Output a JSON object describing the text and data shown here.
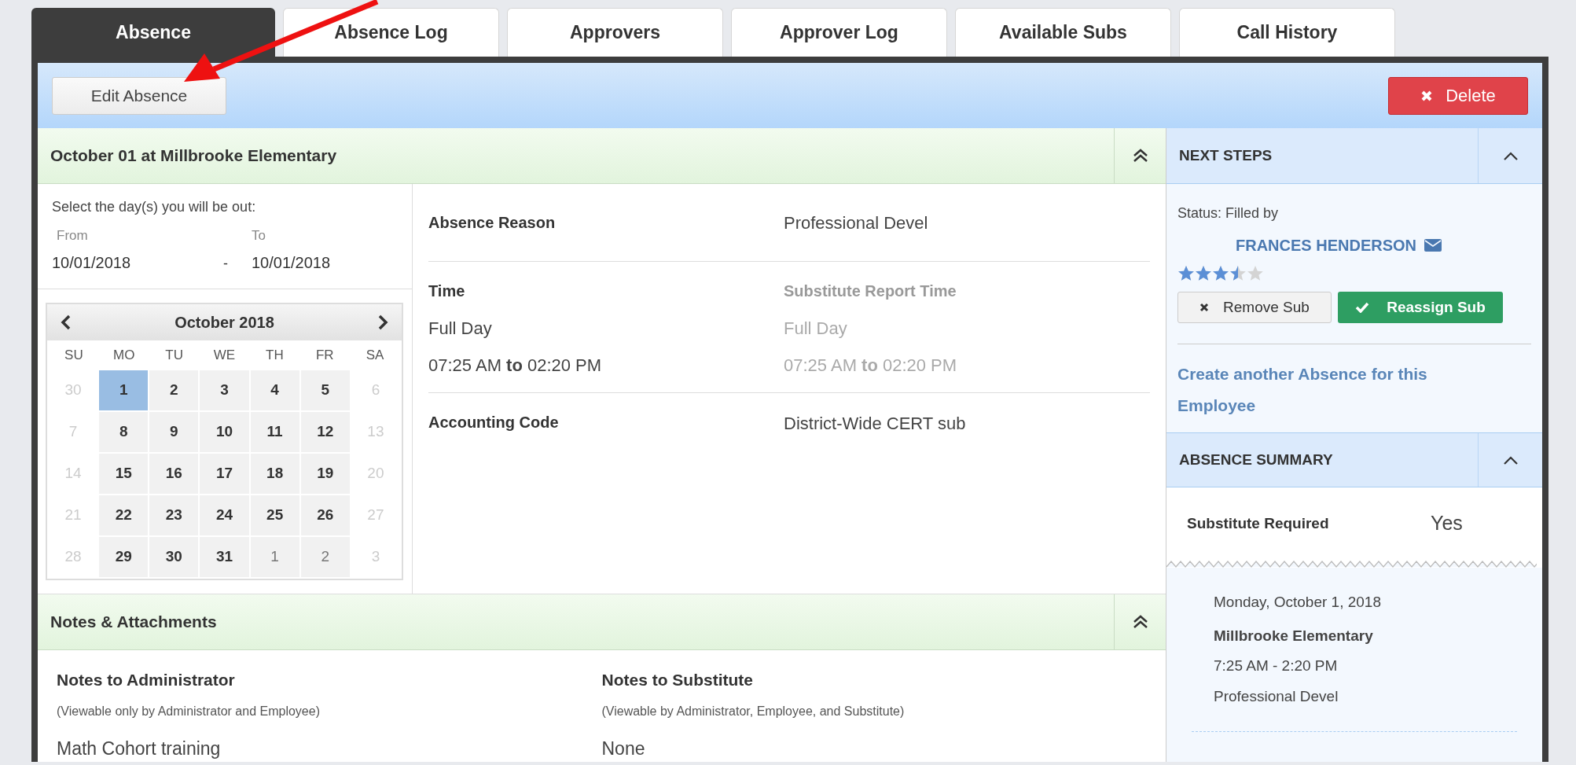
{
  "tabs": [
    {
      "label": "Absence",
      "selected": true
    },
    {
      "label": "Absence Log",
      "selected": false
    },
    {
      "label": "Approvers",
      "selected": false
    },
    {
      "label": "Approver Log",
      "selected": false
    },
    {
      "label": "Available Subs",
      "selected": false
    },
    {
      "label": "Call History",
      "selected": false
    }
  ],
  "toolbar": {
    "edit_button": "Edit Absence",
    "delete_button": "Delete"
  },
  "absence": {
    "title": "October 01 at Millbrooke Elementary",
    "day_picker": {
      "prompt": "Select the day(s) you will be out:",
      "from_label": "From",
      "to_label": "To",
      "from_value": "10/01/2018",
      "separator": "-",
      "to_value": "10/01/2018"
    },
    "calendar": {
      "month": "October 2018",
      "weekdays": [
        "SU",
        "MO",
        "TU",
        "WE",
        "TH",
        "FR",
        "SA"
      ],
      "weeks": [
        [
          {
            "day": "30",
            "kind": "weekend",
            "selected": false
          },
          {
            "day": "1",
            "kind": "weekday",
            "selected": true
          },
          {
            "day": "2",
            "kind": "weekday",
            "selected": false
          },
          {
            "day": "3",
            "kind": "weekday",
            "selected": false
          },
          {
            "day": "4",
            "kind": "weekday",
            "selected": false
          },
          {
            "day": "5",
            "kind": "weekday",
            "selected": false
          },
          {
            "day": "6",
            "kind": "weekend",
            "selected": false
          }
        ],
        [
          {
            "day": "7",
            "kind": "weekend",
            "selected": false
          },
          {
            "day": "8",
            "kind": "weekday",
            "selected": false
          },
          {
            "day": "9",
            "kind": "weekday",
            "selected": false
          },
          {
            "day": "10",
            "kind": "weekday",
            "selected": false
          },
          {
            "day": "11",
            "kind": "weekday",
            "selected": false
          },
          {
            "day": "12",
            "kind": "weekday",
            "selected": false
          },
          {
            "day": "13",
            "kind": "weekend",
            "selected": false
          }
        ],
        [
          {
            "day": "14",
            "kind": "weekend",
            "selected": false
          },
          {
            "day": "15",
            "kind": "weekday",
            "selected": false
          },
          {
            "day": "16",
            "kind": "weekday",
            "selected": false
          },
          {
            "day": "17",
            "kind": "weekday",
            "selected": false
          },
          {
            "day": "18",
            "kind": "weekday",
            "selected": false
          },
          {
            "day": "19",
            "kind": "weekday",
            "selected": false
          },
          {
            "day": "20",
            "kind": "weekend",
            "selected": false
          }
        ],
        [
          {
            "day": "21",
            "kind": "weekend",
            "selected": false
          },
          {
            "day": "22",
            "kind": "weekday",
            "selected": false
          },
          {
            "day": "23",
            "kind": "weekday",
            "selected": false
          },
          {
            "day": "24",
            "kind": "weekday",
            "selected": false
          },
          {
            "day": "25",
            "kind": "weekday",
            "selected": false
          },
          {
            "day": "26",
            "kind": "weekday",
            "selected": false
          },
          {
            "day": "27",
            "kind": "weekend",
            "selected": false
          }
        ],
        [
          {
            "day": "28",
            "kind": "weekend",
            "selected": false
          },
          {
            "day": "29",
            "kind": "weekday",
            "selected": false
          },
          {
            "day": "30",
            "kind": "weekday",
            "selected": false
          },
          {
            "day": "31",
            "kind": "weekday",
            "selected": false
          },
          {
            "day": "1",
            "kind": "adjacent",
            "selected": false
          },
          {
            "day": "2",
            "kind": "adjacent",
            "selected": false
          },
          {
            "day": "3",
            "kind": "weekend",
            "selected": false
          }
        ]
      ]
    },
    "details": {
      "reason_label": "Absence Reason",
      "reason_value": "Professional Devel",
      "time_label": "Time",
      "report_time_label": "Substitute Report Time",
      "time_value": "Full Day",
      "report_time_value": "Full Day",
      "time_range": "07:25 AM **to** 02:20 PM",
      "report_range": "07:25 AM **to** 02:20 PM",
      "code_label": "Accounting Code",
      "code_value": "District-Wide CERT sub"
    }
  },
  "notes": {
    "title": "Notes & Attachments",
    "columns": [
      {
        "heading": "Notes to Administrator",
        "hint": "(Viewable only by Administrator and Employee)",
        "value": "Math Cohort training"
      },
      {
        "heading": "Notes to Substitute",
        "hint": "(Viewable by Administrator, Employee, and Substitute)",
        "value": "None"
      }
    ]
  },
  "next_steps": {
    "title": "NEXT STEPS",
    "status": "Status: Filled by",
    "name": "FRANCES HENDERSON",
    "stars": 3.5,
    "remove_button": "Remove Sub",
    "reassign_button": "Reassign Sub",
    "create_link": "Create another Absence for this Employee"
  },
  "summary": {
    "title": "ABSENCE SUMMARY",
    "rows": [
      {
        "label": "Substitute Required",
        "value": "Yes"
      }
    ],
    "entry": {
      "date": "Monday, October 1, 2018",
      "school": "Millbrooke Elementary",
      "time": "7:25 AM - 2:20 PM",
      "reason": "Professional Devel"
    }
  }
}
